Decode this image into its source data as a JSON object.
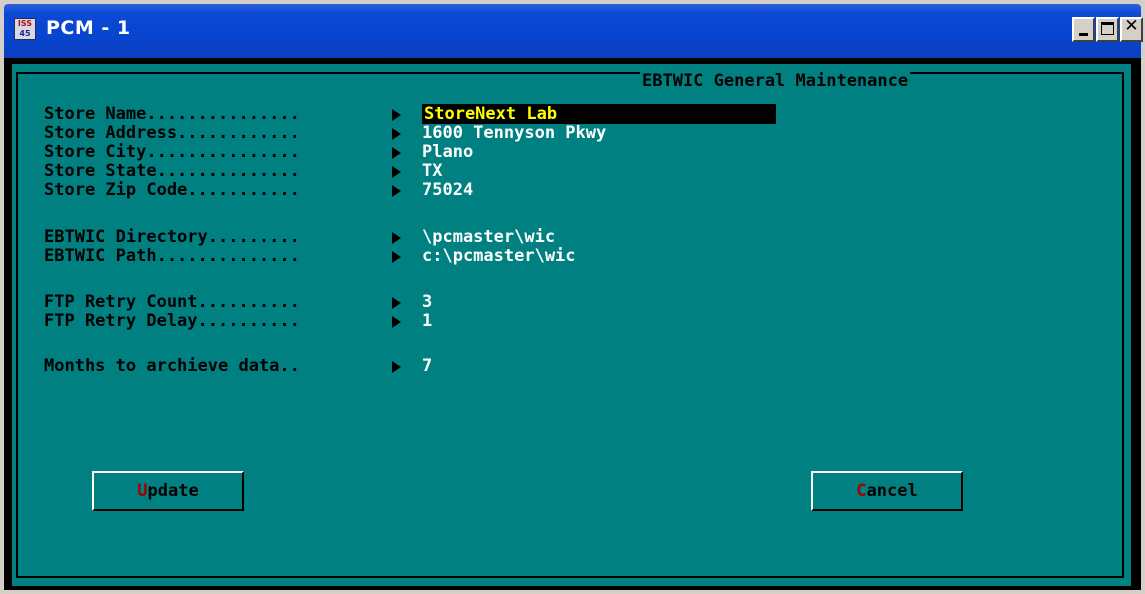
{
  "window": {
    "title": "PCM - 1",
    "icon_text_top": "ISS",
    "icon_text_bottom": "45"
  },
  "panel": {
    "title": "EBTWIC General Maintenance"
  },
  "fields": [
    {
      "label": "Store Name...............",
      "value": "StoreNext Lab"
    },
    {
      "label": "Store Address............",
      "value": "1600 Tennyson Pkwy"
    },
    {
      "label": "Store City...............",
      "value": "Plano"
    },
    {
      "label": "Store State..............",
      "value": "TX"
    },
    {
      "label": "Store Zip Code...........",
      "value": "75024"
    },
    {
      "label": "EBTWIC Directory.........",
      "value": "\\pcmaster\\wic"
    },
    {
      "label": "EBTWIC Path..............",
      "value": "c:\\pcmaster\\wic"
    },
    {
      "label": "FTP Retry Count..........",
      "value": "3"
    },
    {
      "label": "FTP Retry Delay..........",
      "value": "1"
    },
    {
      "label": "Months to archieve data..",
      "value": "7"
    }
  ],
  "buttons": {
    "update": {
      "hotkey": "U",
      "rest": "pdate"
    },
    "cancel": {
      "hotkey": "C",
      "rest": "ancel"
    }
  },
  "colors": {
    "background": "#008080",
    "focus_text": "#ffff00",
    "hotkey": "#a00000"
  }
}
